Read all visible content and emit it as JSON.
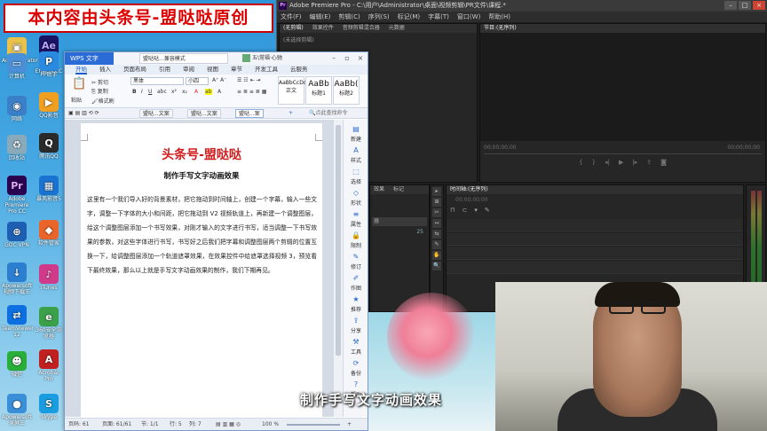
{
  "watermark": "本内容由头条号-盟哒哒原创",
  "desktop": {
    "col1": [
      {
        "label": "Administrator",
        "icon": "user-folder-icon",
        "color": "#e8c24a"
      },
      {
        "label": "计算机",
        "icon": "computer-icon",
        "color": "#4a90d9"
      },
      {
        "label": "网络",
        "icon": "network-icon",
        "color": "#3a7fc8"
      },
      {
        "label": "回收站",
        "icon": "recycle-bin-icon",
        "color": "#8ab"
      },
      {
        "label": "Adobe Premiere Pro CC",
        "icon": "premiere-icon",
        "color": "#2a0050"
      },
      {
        "label": "GOC VPN",
        "icon": "vpn-icon",
        "color": "#1e5fb4"
      },
      {
        "label": "Apowersoft视频下载王",
        "icon": "apowersoft-icon",
        "color": "#2c7fd0"
      },
      {
        "label": "TeamViewer 12",
        "icon": "teamviewer-icon",
        "color": "#0d6fe0"
      },
      {
        "label": "微信",
        "icon": "wechat-icon",
        "color": "#2aae3a"
      },
      {
        "label": "Apowersoft录屏王",
        "icon": "screen-recorder-icon",
        "color": "#3a8fd8"
      }
    ],
    "col2": [
      {
        "label": "Adobe After Effects CC",
        "icon": "after-effects-icon",
        "color": "#1b1464"
      },
      {
        "label": "PP助手",
        "icon": "pp-assistant-icon",
        "color": "#2b8ae0"
      },
      {
        "label": "QQ影音",
        "icon": "qq-player-icon",
        "color": "#f0a020"
      },
      {
        "label": "QQ",
        "icon": "qq-icon",
        "color": "#2a2a2a"
      },
      {
        "label": "腾讯QQ",
        "icon": "tencent-qq-icon",
        "color": "#222"
      },
      {
        "label": "暴风影音5",
        "icon": "storm-player-icon",
        "color": "#1a73d0"
      },
      {
        "label": "软件管家",
        "icon": "software-manager-icon",
        "color": "#e9652a"
      },
      {
        "label": "iTunes",
        "icon": "itunes-icon",
        "color": "#d03a8a"
      },
      {
        "label": "360安全浏览器",
        "icon": "browser-360-icon",
        "color": "#3aa04a"
      },
      {
        "label": "Acrobat Pro",
        "icon": "acrobat-icon",
        "color": "#c02020"
      },
      {
        "label": "Skype",
        "icon": "skype-icon",
        "color": "#1a9de0"
      }
    ]
  },
  "premiere": {
    "title": "Adobe Premiere Pro - C:\\用户\\Administrator\\桌面\\视频剪辑\\PR文件\\课程.*",
    "menu": [
      "文件(F)",
      "编辑(E)",
      "剪辑(C)",
      "序列(S)",
      "标记(M)",
      "字幕(T)",
      "窗口(W)",
      "帮助(H)"
    ],
    "source_tabs": [
      "(无剪辑)",
      "效果控件",
      "音频剪辑混合器",
      "元数据"
    ],
    "source_empty": "(未选择剪辑)",
    "program_tab": "节目:(无序列)",
    "timecode_left": "00;00;00;00",
    "timecode_right": "00;00;00;00",
    "project_tabs": [
      "效果",
      "标记"
    ],
    "project_items": [
      "器",
      "25"
    ],
    "timeline_tab": "时间轴:(无序列)",
    "timeline_tc": "00;00;00;00",
    "tools": [
      "▸",
      "⊞",
      "✂",
      "↔",
      "⇆",
      "✎",
      "✋",
      "🔍"
    ]
  },
  "wps": {
    "brand": "WPS 文字",
    "doc_tab": "盟哒哒...兼容模式",
    "user": "五\\常福·心驰",
    "ribbon_tabs": [
      "开始",
      "插入",
      "页面布局",
      "引用",
      "审阅",
      "视图",
      "章节",
      "开发工具",
      "云服务"
    ],
    "ribbon": {
      "paste": "粘贴",
      "cut": "剪切",
      "copy": "复制",
      "format_painter": "格式刷",
      "font": "黑体",
      "size": "小四",
      "styles": [
        "正文",
        "标题1",
        "标题2"
      ],
      "style_samples": [
        "AaBbCcDd",
        "AaBb",
        "AaBb("
      ]
    },
    "doc_tabs": [
      "盟哒...文案",
      "盟哒...文案",
      "盟哒...案"
    ],
    "search": "点此查找命令",
    "side": [
      "新建",
      "样式",
      "选择",
      "形状",
      "属性",
      "限制",
      "修订",
      "作图",
      "推荐",
      "分享",
      "工具",
      "备份",
      "帮助"
    ],
    "doc": {
      "heading": "头条号-盟哒哒",
      "subheading": "制作手写文字动画效果",
      "body": "这里有一个我们导入好的背景素材，把它拖动到时间轴上，创建一个字幕，输入一些文字，调整一下字体的大小和间距，把它拖动到 V2 视频轨道上，再新建一个调整图层，给这个调整图层添加一个书写效果，对刚才输入的文字进行书写，适当调整一下书写效果的参数，对这些字体进行书写，书写好之后我们把字幕和调整图层两个剪辑的位置互换一下，给调整图层添加一个轨道遮罩效果，在效果控件中给遮罩选择视频 3，预览看下最终效果，那么以上就是手写文字动画效果的制作，我们下期再见。"
    },
    "status": {
      "page": "页码: 61",
      "pages": "页面: 61/61",
      "section": "节: 1/1",
      "row": "行: 5",
      "col": "列: 7",
      "zoom": "100 %"
    }
  },
  "caption": "制作手写文字动画效果"
}
